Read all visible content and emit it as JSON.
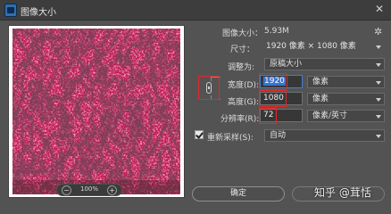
{
  "window": {
    "title": "图像大小",
    "close_glyph": "✕"
  },
  "preview": {
    "zoom_level": "100%",
    "zoom_out_glyph": "−",
    "zoom_in_glyph": "+"
  },
  "info": {
    "image_size_label": "图像大小：",
    "image_size_value": "5.93M",
    "dimensions_label": "尺寸：",
    "dimensions_value": "1920 像素 × 1080 像素"
  },
  "fit_to": {
    "label": "调整为:",
    "value": "原稿大小"
  },
  "width": {
    "label": "宽度(D):",
    "value": "1920",
    "unit": "像素"
  },
  "height": {
    "label": "高度(G):",
    "value": "1080",
    "unit": "像素"
  },
  "resolution": {
    "label": "分辨率(R):",
    "value": "72",
    "unit": "像素/英寸"
  },
  "resample": {
    "label": "重新采样(S):",
    "checked": true,
    "value": "自动"
  },
  "buttons": {
    "ok": "确定",
    "cancel": ""
  },
  "watermark": "知乎 @茸恬",
  "colors": {
    "accent": "#3a73d0",
    "annotation_red": "#e02a2a",
    "dialog_bg": "#535353",
    "titlebar_bg": "#3d3d3d"
  }
}
